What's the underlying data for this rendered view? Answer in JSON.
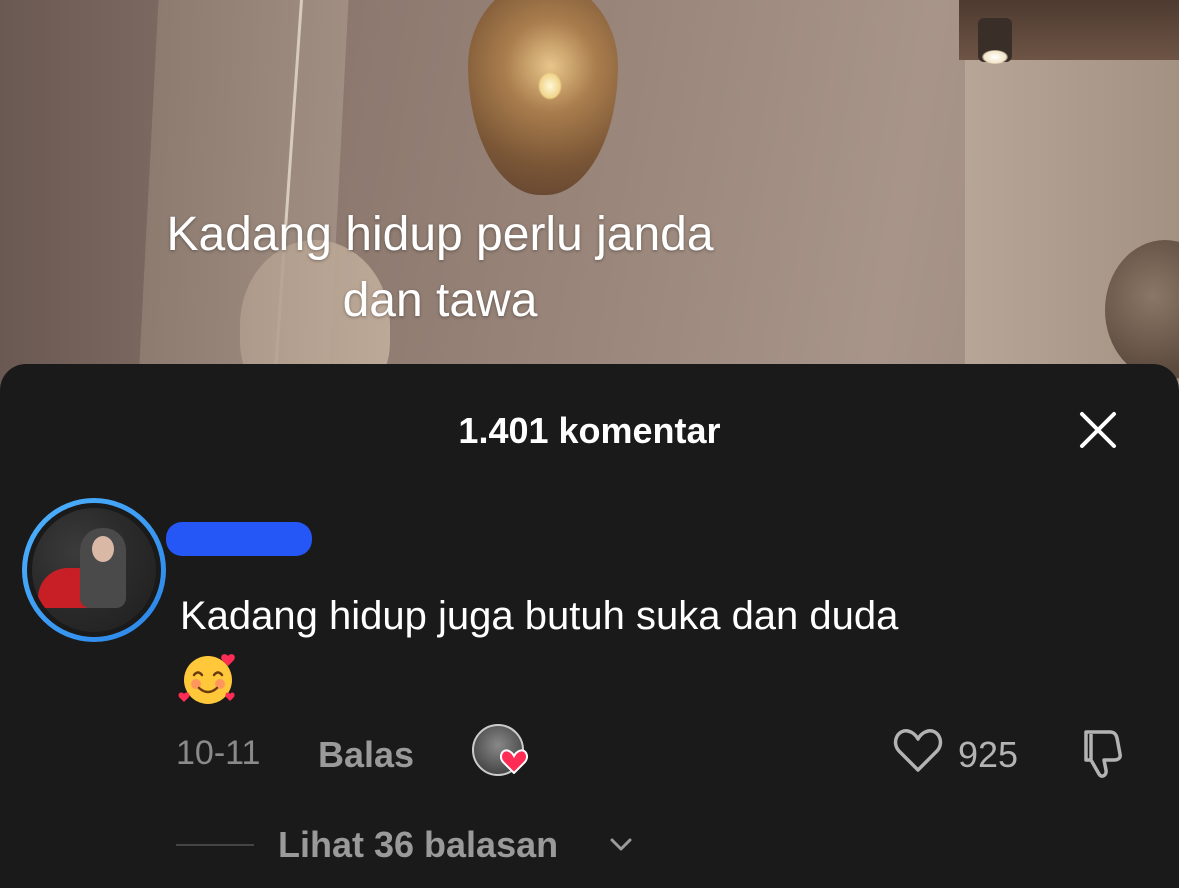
{
  "video": {
    "caption_line1": "Kadang hidup perlu janda",
    "caption_line2": "dan tawa"
  },
  "comments_sheet": {
    "title": "1.401 komentar",
    "close_icon": "close-icon",
    "comment": {
      "text": "Kadang hidup juga butuh suka dan duda",
      "emoji": "smiling-face-with-hearts",
      "date": "10-11",
      "reply_label": "Balas",
      "like_count": "925",
      "view_replies_label": "Lihat 36 balasan"
    }
  },
  "colors": {
    "sheet_bg": "#1a1a1a",
    "avatar_ring": "#2a84e8",
    "redaction": "#2457f5",
    "heart_red": "#ff2d55"
  }
}
